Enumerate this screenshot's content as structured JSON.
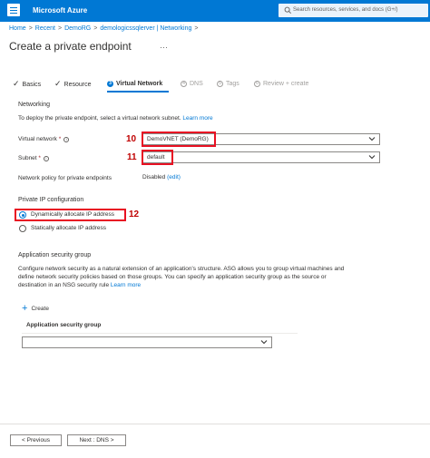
{
  "header": {
    "brand": "Microsoft Azure",
    "search_placeholder": "Search resources, services, and docs (G+/)"
  },
  "breadcrumb": [
    "Home",
    "Recent",
    "DemoRG",
    "demologicssqlerver | Networking"
  ],
  "page": {
    "title": "Create a private endpoint",
    "more": "···"
  },
  "tabs": [
    {
      "label": "Basics",
      "state": "done"
    },
    {
      "label": "Resource",
      "state": "done"
    },
    {
      "num": "3",
      "label": "Virtual Network",
      "state": "active"
    },
    {
      "num": "4",
      "label": "DNS",
      "state": "disabled"
    },
    {
      "num": "5",
      "label": "Tags",
      "state": "disabled"
    },
    {
      "num": "6",
      "label": "Review + create",
      "state": "disabled"
    }
  ],
  "networking": {
    "intro": "To deploy the private endpoint, select a virtual network subnet.",
    "learn_more": "Learn more",
    "section_title": "Networking",
    "vnet_label": "Virtual network",
    "vnet_value": "DemoVNET (DemoRG)",
    "subnet_label": "Subnet",
    "subnet_value": "default",
    "policy_label": "Network policy for private endpoints",
    "policy_value": "Disabled",
    "policy_edit": "(edit)"
  },
  "private_ip": {
    "section_title": "Private IP configuration",
    "option_dynamic": "Dynamically allocate IP address",
    "option_static": "Statically allocate IP address",
    "selected": "dynamic"
  },
  "asg": {
    "section_title": "Application security group",
    "description_line1": "Configure network security as a natural extension of an application's structure. ASG allows you to group virtual machines and",
    "description_line2": "define network security policies based on those groups. You can specify an application security group as the source or",
    "description_line3": "destination in an NSG security rule",
    "learn_more": "Learn more",
    "create_label": "Create",
    "column_header": "Application security group",
    "dropdown_value": ""
  },
  "callouts": {
    "vnet": "10",
    "subnet": "11",
    "private_ip": "12"
  },
  "footer": {
    "previous": "< Previous",
    "next": "Next : DNS >"
  },
  "colors": {
    "accent": "#0078d4",
    "callout": "#e81123"
  }
}
